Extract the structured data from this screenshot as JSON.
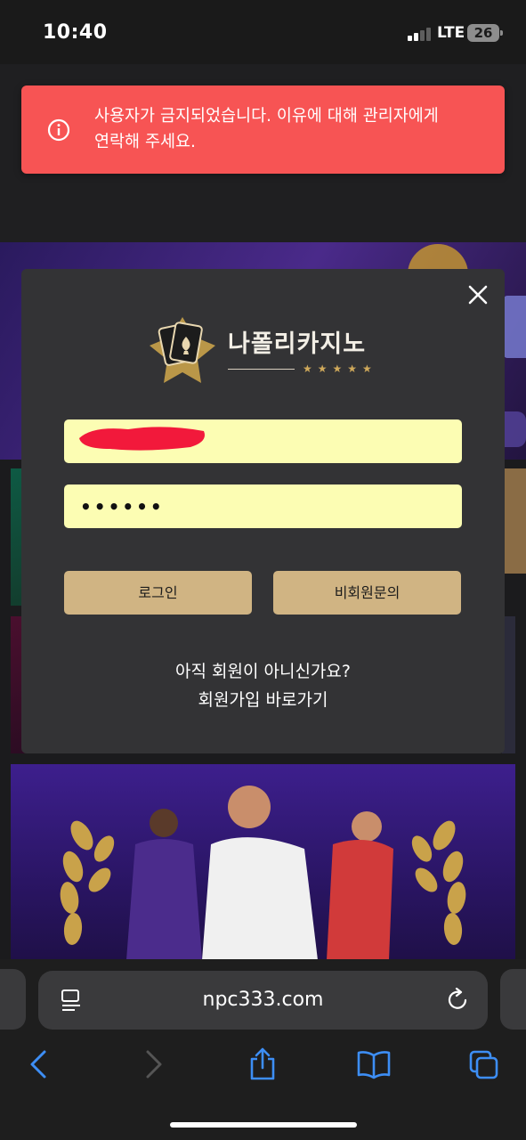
{
  "status_bar": {
    "time": "10:40",
    "network": "LTE",
    "battery": "26"
  },
  "toast": {
    "message": "사용자가 금지되었습니다. 이유에 대해 관리자에게 연락해 주세요.",
    "icon": "info-icon",
    "color": "#f75454"
  },
  "login_modal": {
    "logo_text": "나폴리카지노",
    "logo_stars": "★★★★★",
    "username_value": "",
    "password_value": "••••••",
    "login_button": "로그인",
    "guest_inquiry_button": "비회원문의",
    "signup_question": "아직 회원이 아니신가요?",
    "signup_link": "회원가입 바로가기",
    "close_icon": "close-icon",
    "input_color": "#fcfdb3",
    "button_color": "#d0b483"
  },
  "browser": {
    "url": "npc333.com",
    "toolbar": [
      "back-icon",
      "forward-icon",
      "share-icon",
      "bookmarks-icon",
      "tabs-icon"
    ]
  }
}
